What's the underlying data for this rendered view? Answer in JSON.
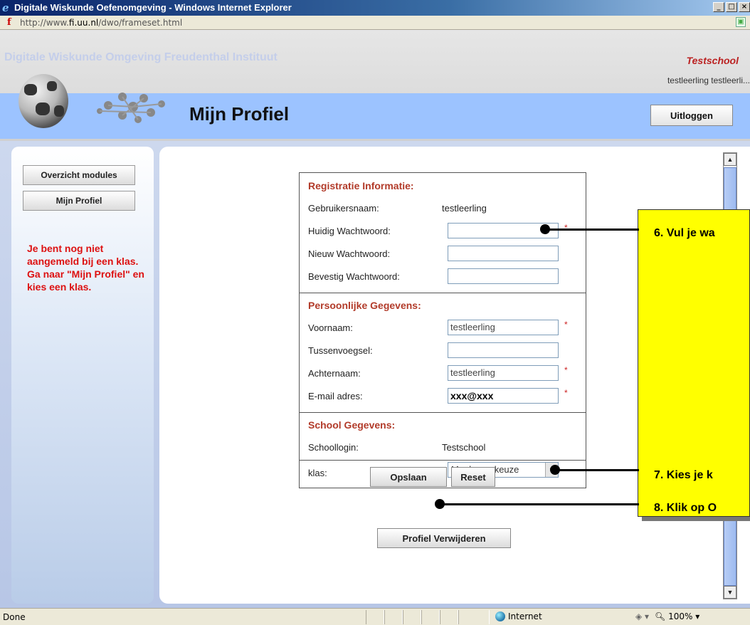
{
  "window": {
    "title": "Digitale Wiskunde Oefenomgeving - Windows Internet Explorer",
    "minimize": "_",
    "maximize": "□",
    "close": "×"
  },
  "address": {
    "url_prefix": "http://www.",
    "url_domain": "fi.uu.nl",
    "url_path": "/dwo/frameset.html"
  },
  "header": {
    "site_name": "Digitale Wiskunde Omgeving  Freudenthal Instituut",
    "school": "Testschool",
    "user": "testleerling testleerli...",
    "page_title": "Mijn Profiel",
    "logout_label": "Uitloggen"
  },
  "sidebar": {
    "items": [
      {
        "label": "Overzicht modules"
      },
      {
        "label": "Mijn Profiel"
      }
    ],
    "notice": "Je bent nog niet aangemeld bij een klas. Ga naar \"Mijn Profiel\" en kies een klas."
  },
  "form": {
    "registration": {
      "title": "Registratie Informatie:",
      "username_label": "Gebruikersnaam:",
      "username_value": "testleerling",
      "current_pw_label": "Huidig Wachtwoord:",
      "new_pw_label": "Nieuw Wachtwoord:",
      "confirm_pw_label": "Bevestig Wachtwoord:"
    },
    "personal": {
      "title": "Persoonlijke Gegevens:",
      "firstname_label": "Voornaam:",
      "firstname_value": "testleerling",
      "infix_label": "Tussenvoegsel:",
      "infix_value": "",
      "lastname_label": "Achternaam:",
      "lastname_value": "testleerling",
      "email_label": "E-mail adres:",
      "email_value": "xxx@xxx"
    },
    "school": {
      "title": "School Gegevens:",
      "login_label": "Schoollogin:",
      "login_value": "Testschool",
      "class_label": "klas:",
      "class_selected": "Maak een keuze"
    },
    "required_mark": "*",
    "save_label": "Opslaan",
    "reset_label": "Reset",
    "delete_label": "Profiel Verwijderen"
  },
  "callout": {
    "step6": "6. Vul je wa",
    "step7": "7. Kies je k",
    "step8": "8. Klik op O"
  },
  "statusbar": {
    "status": "Done",
    "zone": "Internet",
    "zoom": "100%"
  },
  "colors": {
    "accent_blue": "#9cc3ff",
    "section_title": "#b23b2a",
    "notice_red": "#dd1111",
    "callout_yellow": "#ffff00"
  }
}
